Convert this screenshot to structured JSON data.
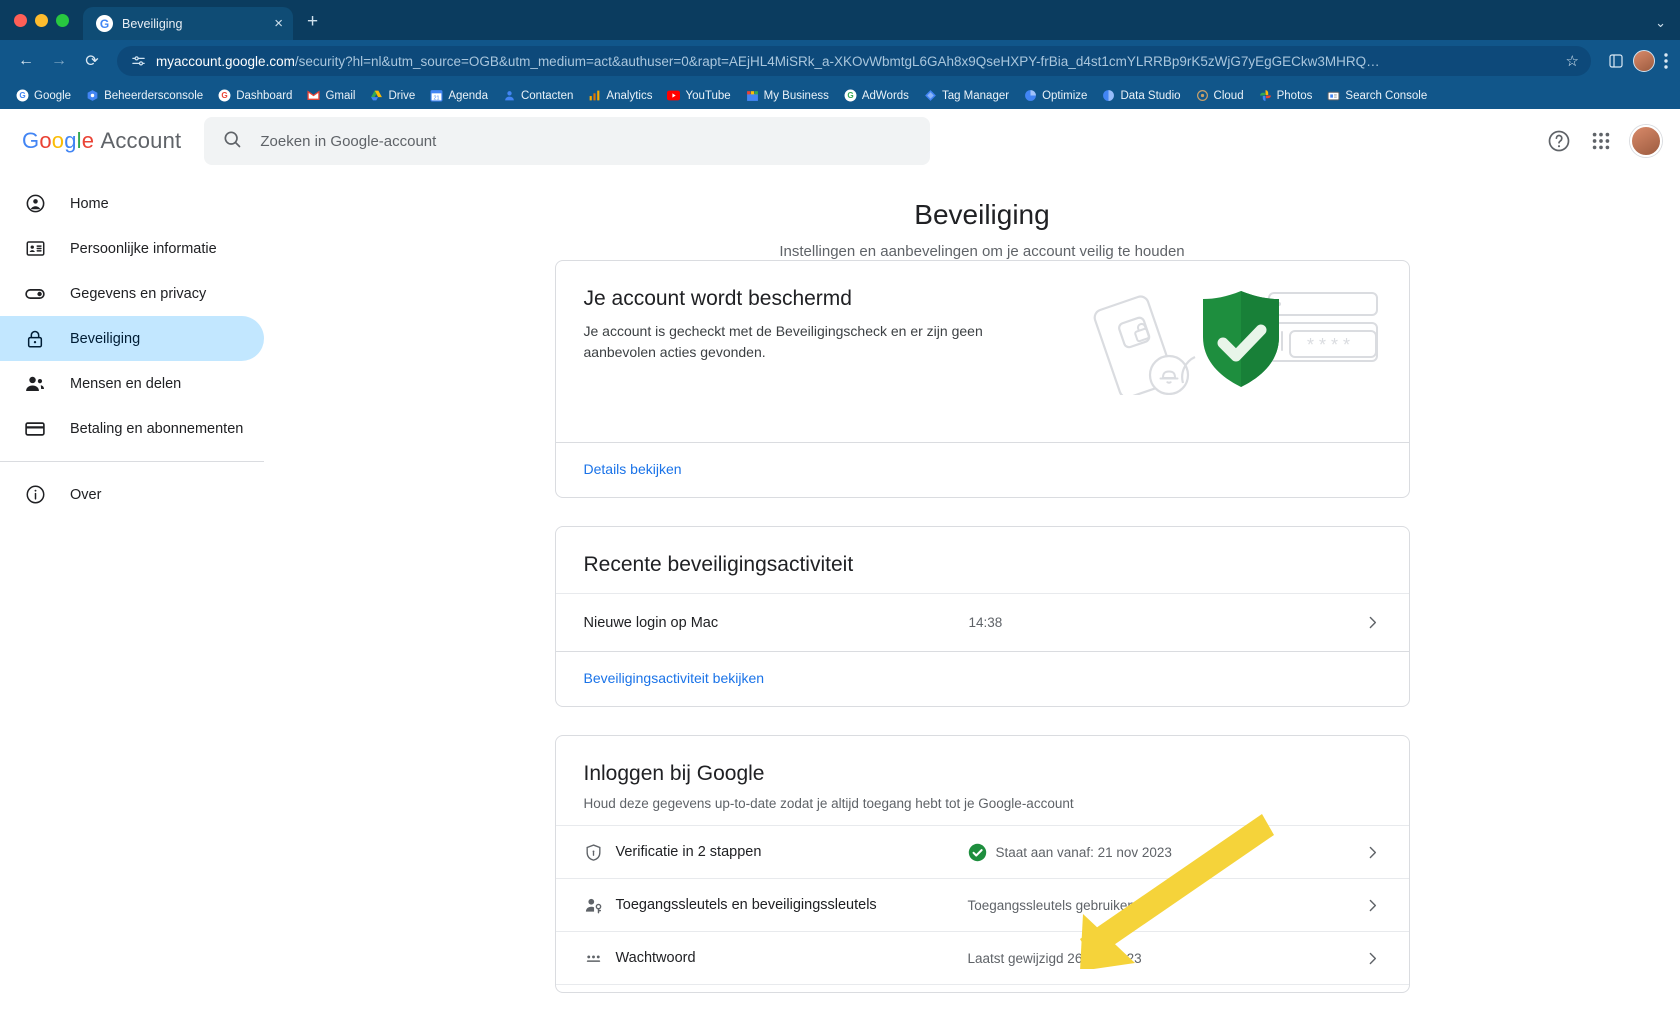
{
  "browser": {
    "tab": {
      "title": "Beveiliging",
      "favicon": "google-g-icon",
      "close": "×"
    },
    "new_tab": "+",
    "window_chevron": "⌄",
    "nav": {
      "back": "←",
      "forward": "→",
      "reload": "⟳"
    },
    "omnibox": {
      "site_icon": "tune-icon",
      "url_bold": "myaccount.google.com",
      "url_rest": "/security?hl=nl&utm_source=OGB&utm_medium=act&authuser=0&rapt=AEjHL4MiSRk_a-XKOvWbmtgL6GAh8x9QseHXPY-frBia_d4st1cmYLRRBp9rK5zWjG7yEgGECkw3MHRQ…",
      "star": "☆"
    },
    "bookmarks": [
      {
        "label": "Google",
        "icon": "google-g-icon"
      },
      {
        "label": "Beheerdersconsole",
        "icon": "admin-console-icon"
      },
      {
        "label": "Dashboard",
        "icon": "google-g-icon"
      },
      {
        "label": "Gmail",
        "icon": "gmail-icon"
      },
      {
        "label": "Drive",
        "icon": "drive-icon"
      },
      {
        "label": "Agenda",
        "icon": "calendar-icon"
      },
      {
        "label": "Contacten",
        "icon": "contacts-icon"
      },
      {
        "label": "Analytics",
        "icon": "analytics-icon"
      },
      {
        "label": "YouTube",
        "icon": "youtube-icon"
      },
      {
        "label": "My Business",
        "icon": "my-business-icon"
      },
      {
        "label": "AdWords",
        "icon": "adwords-icon"
      },
      {
        "label": "Tag Manager",
        "icon": "tag-manager-icon"
      },
      {
        "label": "Optimize",
        "icon": "optimize-icon"
      },
      {
        "label": "Data Studio",
        "icon": "data-studio-icon"
      },
      {
        "label": "Cloud",
        "icon": "cloud-icon"
      },
      {
        "label": "Photos",
        "icon": "photos-icon"
      },
      {
        "label": "Search Console",
        "icon": "search-console-icon"
      }
    ]
  },
  "header": {
    "brand_google": "Google",
    "brand_account": "Account",
    "search_placeholder": "Zoeken in Google-account",
    "help_icon": "help-circle-icon",
    "apps_icon": "apps-grid-icon",
    "avatar": "user-avatar"
  },
  "sidebar": {
    "items": [
      {
        "label": "Home",
        "icon": "account-circle-icon",
        "active": false
      },
      {
        "label": "Persoonlijke informatie",
        "icon": "id-card-icon",
        "active": false
      },
      {
        "label": "Gegevens en privacy",
        "icon": "toggle-icon",
        "active": false
      },
      {
        "label": "Beveiliging",
        "icon": "lock-icon",
        "active": true
      },
      {
        "label": "Mensen en delen",
        "icon": "people-icon",
        "active": false
      },
      {
        "label": "Betaling en abonnementen",
        "icon": "credit-card-icon",
        "active": false
      }
    ],
    "about": {
      "label": "Over",
      "icon": "info-circle-icon"
    }
  },
  "main": {
    "title": "Beveiliging",
    "subtitle": "Instellingen en aanbevelingen om je account veilig te houden",
    "protected_card": {
      "heading": "Je account wordt beschermd",
      "description": "Je account is gecheckt met de Beveiligingscheck en er zijn geen aanbevolen acties gevonden.",
      "link": "Details bekijken",
      "illustration": "security-shield-check-illustration"
    },
    "activity_card": {
      "heading": "Recente beveiligingsactiviteit",
      "rows": [
        {
          "title": "Nieuwe login op Mac",
          "meta": "14:38",
          "chevron": "›"
        }
      ],
      "link": "Beveiligingsactiviteit bekijken"
    },
    "signin_card": {
      "heading": "Inloggen bij Google",
      "subtitle": "Houd deze gegevens up-to-date zodat je altijd toegang hebt tot je Google-account",
      "rows": [
        {
          "icon": "shield-outline-icon",
          "title": "Verificatie in 2 stappen",
          "meta": "Staat aan vanaf: 21 nov 2023",
          "status": "ok",
          "chevron": "›"
        },
        {
          "icon": "passkey-person-icon",
          "title": "Toegangssleutels en beveiligingssleutels",
          "meta": "Toegangssleutels gebruiken",
          "status": "none",
          "chevron": "›"
        },
        {
          "icon": "password-dots-icon",
          "title": "Wachtwoord",
          "meta": "Laatst gewijzigd 26 dec 2023",
          "status": "none",
          "chevron": "›"
        }
      ]
    }
  },
  "annotation": {
    "arrow": "yellow-pointer-arrow",
    "color": "#F5D33A"
  },
  "colors": {
    "chrome_tabstrip": "#0b3c5f",
    "chrome_toolbar": "#11568a",
    "sidebar_active": "#c2e7ff",
    "link_blue": "#1a73e8",
    "status_green": "#1e8e3e",
    "arrow_yellow": "#F5D33A"
  }
}
